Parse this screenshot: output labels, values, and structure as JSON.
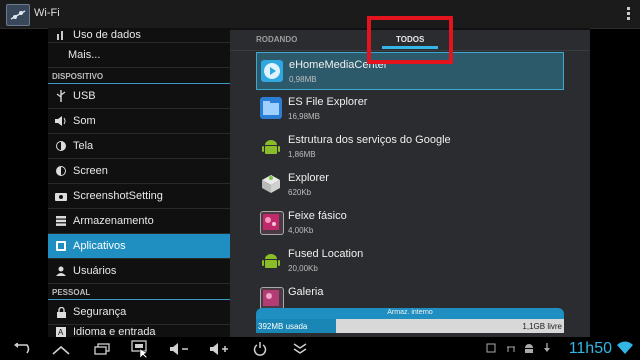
{
  "topbar": {
    "title": "Wi-Fi",
    "icon": "settings-sliders-icon"
  },
  "settings": {
    "items": [
      {
        "label": "Uso de dados",
        "icon": "data-usage-icon",
        "cut": true
      },
      {
        "label": "Mais...",
        "icon": ""
      },
      {
        "header": "DISPOSITIVO"
      },
      {
        "label": "USB",
        "icon": "usb-icon"
      },
      {
        "label": "Som",
        "icon": "speaker-icon"
      },
      {
        "label": "Tela",
        "icon": "brightness-icon"
      },
      {
        "label": "Screen",
        "icon": "screen-icon"
      },
      {
        "label": "ScreenshotSetting",
        "icon": "camera-icon"
      },
      {
        "label": "Armazenamento",
        "icon": "storage-icon"
      },
      {
        "label": "Aplicativos",
        "icon": "apps-icon",
        "active": true
      },
      {
        "label": "Usuários",
        "icon": "user-icon"
      },
      {
        "header": "PESSOAL"
      },
      {
        "label": "Segurança",
        "icon": "lock-icon"
      },
      {
        "label": "Idioma e entrada",
        "icon": "language-icon",
        "cut": true
      }
    ]
  },
  "apps_panel": {
    "tab_running": "RODANDO",
    "tab_all": "TODOS",
    "apps": [
      {
        "name": "eHomeMediaCenter",
        "size": "0,98MB",
        "selected": true,
        "icon": "media-center-icon",
        "color": "#2fa7e0"
      },
      {
        "name": "ES File Explorer",
        "size": "16,98MB",
        "icon": "folder-icon",
        "color": "#2a7fd4"
      },
      {
        "name": "Estrutura dos serviços do Google",
        "size": "1,86MB",
        "icon": "android-icon",
        "color": "#8bbd2a"
      },
      {
        "name": "Explorer",
        "size": "620Kb",
        "icon": "explorer-icon",
        "color": "#d7d7d7"
      },
      {
        "name": "Feixe fásico",
        "size": "4,00Kb",
        "icon": "particles-icon",
        "color": "#c02a6b"
      },
      {
        "name": "Fused Location",
        "size": "20,00Kb",
        "icon": "android-icon",
        "color": "#8bbd2a"
      },
      {
        "name": "Galeria",
        "size": "",
        "icon": "gallery-icon",
        "color": "#b33c74"
      }
    ],
    "storage": {
      "title": "Armaz. interno",
      "used_label": "392MB usada",
      "free_label": "1,1GB livre",
      "used_fraction": 0.26
    }
  },
  "navbar": {
    "clock": "11h50",
    "buttons": [
      "back-icon",
      "home-icon",
      "recent-apps-icon",
      "screenshot-icon",
      "volume-down-icon",
      "volume-up-icon",
      "power-icon",
      "hide-bar-icon"
    ]
  },
  "colors": {
    "accent": "#33b5e5",
    "active_item": "#1f8fc2",
    "highlight_box": "#e4141e"
  }
}
